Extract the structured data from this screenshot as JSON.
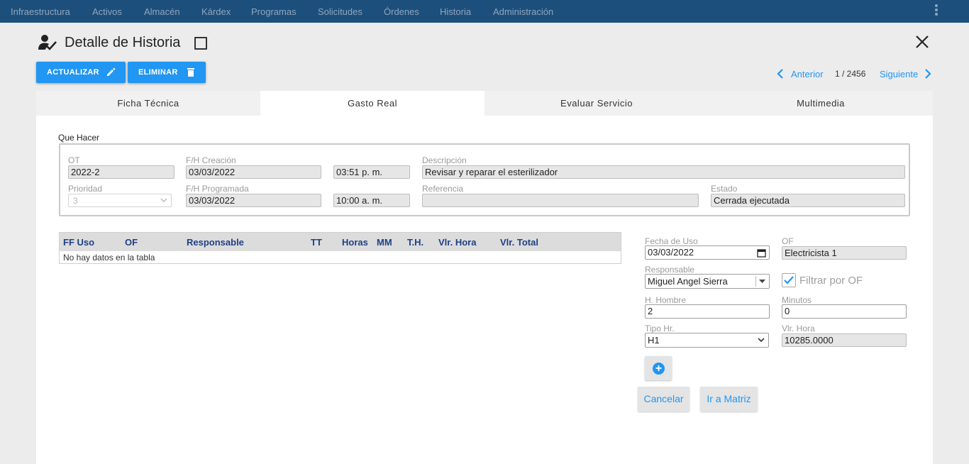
{
  "nav": {
    "items": [
      "Infraestructura",
      "Activos",
      "Almacén",
      "Kárdex",
      "Programas",
      "Solicitudes",
      "Órdenes",
      "Historia",
      "Administración"
    ]
  },
  "header": {
    "title": "Detalle de Historia",
    "icon": "user-check-icon"
  },
  "toolbar": {
    "update_label": "ACTUALIZAR",
    "delete_label": "ELIMINAR"
  },
  "pager": {
    "prev_label": "Anterior",
    "count": "1 / 2456",
    "next_label": "Siguiente"
  },
  "tabs": [
    {
      "label": "Ficha Técnica",
      "active": false
    },
    {
      "label": "Gasto Real",
      "active": true
    },
    {
      "label": "Evaluar Servicio",
      "active": false
    },
    {
      "label": "Multimedia",
      "active": false
    }
  ],
  "que_hacer": {
    "section_label": "Que Hacer",
    "ot_label": "OT",
    "ot_value": "2022-2",
    "creacion_label": "F/H Creación",
    "creacion_date": "03/03/2022",
    "creacion_time": "03:51  p. m.",
    "descripcion_label": "Descripción",
    "descripcion_value": "Revisar y reparar el esterilizador",
    "prioridad_label": "Prioridad",
    "prioridad_value": "3",
    "programada_label": "F/H Programada",
    "programada_date": "03/03/2022",
    "programada_time": "10:00  a. m.",
    "referencia_label": "Referencia",
    "referencia_value": "",
    "estado_label": "Estado",
    "estado_value": "Cerrada ejecutada"
  },
  "table": {
    "columns": [
      "FF Uso",
      "OF",
      "Responsable",
      "TT",
      "Horas",
      "MM",
      "T.H.",
      "Vlr. Hora",
      "Vlr. Total"
    ],
    "empty_text": "No hay datos en la tabla"
  },
  "form": {
    "fecha_uso_label": "Fecha de Uso",
    "fecha_uso_value": "03/03/2022",
    "of_label": "OF",
    "of_value": "Electricista 1",
    "responsable_label": "Responsable",
    "responsable_value": "Miguel Angel Sierra",
    "filtrar_label": "Filtrar por OF",
    "filtrar_checked": true,
    "h_hombre_label": "H. Hombre",
    "h_hombre_value": "2",
    "minutos_label": "Minutos",
    "minutos_value": "0",
    "tipo_hr_label": "Tipo Hr.",
    "tipo_hr_value": "H1",
    "vlr_hora_label": "Vlr. Hora",
    "vlr_hora_value": "10285.0000",
    "add_symbol": "+",
    "cancel_label": "Cancelar",
    "matrix_label": "Ir a Matriz"
  },
  "colors": {
    "nav_bg": "#1d4f7c",
    "accent": "#2196f3",
    "table_header_text": "#1f3f86"
  }
}
